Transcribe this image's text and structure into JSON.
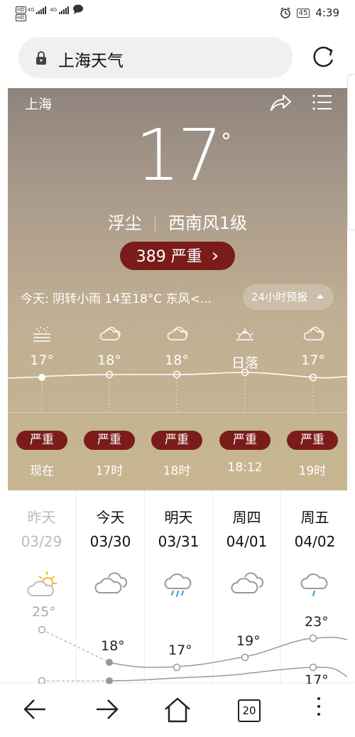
{
  "status_bar": {
    "hd1": "HD",
    "hd2": "HD",
    "net1": "4G",
    "net2": "4G",
    "battery": "45",
    "time": "4:39"
  },
  "search": {
    "query": "上海天气"
  },
  "weather": {
    "city": "上海",
    "temperature": "17",
    "degree_symbol": "°",
    "condition": "浮尘",
    "wind": "西南风1级",
    "aqi_value": "389",
    "aqi_level": "严重",
    "aqi_arrow": "›",
    "today_summary": "今天:  阴转小雨  14至18°C  东风<...",
    "forecast_button": "24小时预报"
  },
  "hourly": [
    {
      "icon": "haze-icon",
      "temp": "17°",
      "aqi": "严重",
      "label": "现在"
    },
    {
      "icon": "cloudy-icon",
      "temp": "18°",
      "aqi": "严重",
      "label": "17时"
    },
    {
      "icon": "cloudy-icon",
      "temp": "18°",
      "aqi": "严重",
      "label": "18时"
    },
    {
      "icon": "sunset-icon",
      "temp": "日落",
      "aqi": "严重",
      "label": "18:12"
    },
    {
      "icon": "cloudy-icon",
      "temp": "17°",
      "aqi": "严重",
      "label": "19时"
    }
  ],
  "daily": [
    {
      "name": "昨天",
      "date": "03/29",
      "icon": "partly-cloudy-icon",
      "high": "25°",
      "low": ""
    },
    {
      "name": "今天",
      "date": "03/30",
      "icon": "cloudy-icon",
      "high": "18°",
      "low": ""
    },
    {
      "name": "明天",
      "date": "03/31",
      "icon": "rain-icon",
      "high": "17°",
      "low": ""
    },
    {
      "name": "周四",
      "date": "04/01",
      "icon": "cloudy-icon",
      "high": "19°",
      "low": ""
    },
    {
      "name": "周五",
      "date": "04/02",
      "icon": "rain-icon",
      "high": "23°",
      "low": "17°"
    }
  ],
  "bottom_nav": {
    "tab_count": "20"
  },
  "colors": {
    "aqi_severe": "#7a1c1a",
    "card_top": "#8f847d",
    "card_bottom": "#c8b791"
  }
}
